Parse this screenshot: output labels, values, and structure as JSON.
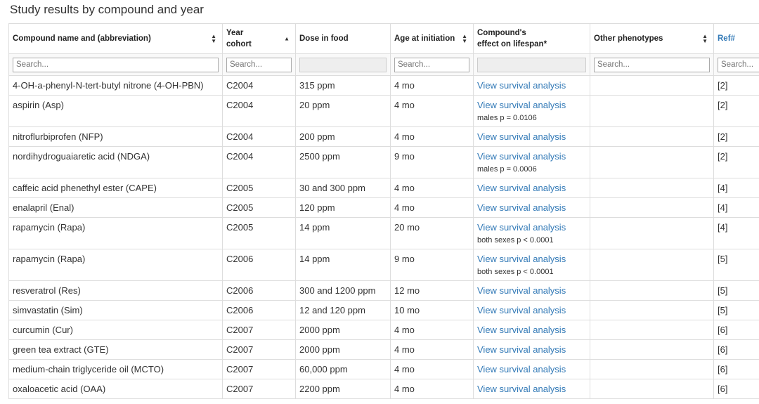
{
  "title": "Study results by compound and year",
  "columns": [
    {
      "line1": "Compound name and (abbreviation)",
      "line2": "",
      "sort": "both"
    },
    {
      "line1": "Year",
      "line2": "cohort",
      "sort": "asc"
    },
    {
      "line1": "Dose in food",
      "line2": "",
      "sort": "none"
    },
    {
      "line1": "Age at initiation",
      "line2": "",
      "sort": "both"
    },
    {
      "line1": "Compound's",
      "line2": "effect on lifespan*",
      "sort": "none"
    },
    {
      "line1": "Other phenotypes",
      "line2": "",
      "sort": "both"
    },
    {
      "line1": "Ref#",
      "line2": "",
      "sort": "none"
    }
  ],
  "filters": [
    "Search...",
    "Search...",
    "",
    "Search...",
    "",
    "Search...",
    "Search..."
  ],
  "link_text": "View survival analysis",
  "rows": [
    {
      "compound": "4-OH-a-phenyl-N-tert-butyl nitrone (4-OH-PBN)",
      "year": "C2004",
      "dose": "315 ppm",
      "age": "4 mo",
      "note": "",
      "other": "",
      "ref": "[2]"
    },
    {
      "compound": "aspirin (Asp)",
      "year": "C2004",
      "dose": "20 ppm",
      "age": "4 mo",
      "note": "males p = 0.0106",
      "other": "",
      "ref": "[2]"
    },
    {
      "compound": "nitroflurbiprofen (NFP)",
      "year": "C2004",
      "dose": "200 ppm",
      "age": "4 mo",
      "note": "",
      "other": "",
      "ref": "[2]"
    },
    {
      "compound": "nordihydroguaiaretic acid (NDGA)",
      "year": "C2004",
      "dose": "2500 ppm",
      "age": "9 mo",
      "note": "males p = 0.0006",
      "other": "",
      "ref": "[2]"
    },
    {
      "compound": "caffeic acid phenethyl ester (CAPE)",
      "year": "C2005",
      "dose": "30 and 300 ppm",
      "age": "4 mo",
      "note": "",
      "other": "",
      "ref": "[4]"
    },
    {
      "compound": "enalapril (Enal)",
      "year": "C2005",
      "dose": "120 ppm",
      "age": "4 mo",
      "note": "",
      "other": "",
      "ref": "[4]"
    },
    {
      "compound": "rapamycin (Rapa)",
      "year": "C2005",
      "dose": "14 ppm",
      "age": "20 mo",
      "note": "both sexes p < 0.0001",
      "other": "",
      "ref": "[4]"
    },
    {
      "compound": "rapamycin (Rapa)",
      "year": "C2006",
      "dose": "14 ppm",
      "age": "9 mo",
      "note": "both sexes p < 0.0001",
      "other": "",
      "ref": "[5]"
    },
    {
      "compound": "resveratrol (Res)",
      "year": "C2006",
      "dose": "300 and 1200 ppm",
      "age": "12 mo",
      "note": "",
      "other": "",
      "ref": "[5]"
    },
    {
      "compound": "simvastatin (Sim)",
      "year": "C2006",
      "dose": "12 and 120 ppm",
      "age": "10 mo",
      "note": "",
      "other": "",
      "ref": "[5]"
    },
    {
      "compound": "curcumin (Cur)",
      "year": "C2007",
      "dose": "2000 ppm",
      "age": "4 mo",
      "note": "",
      "other": "",
      "ref": "[6]"
    },
    {
      "compound": "green tea extract (GTE)",
      "year": "C2007",
      "dose": "2000 ppm",
      "age": "4 mo",
      "note": "",
      "other": "",
      "ref": "[6]"
    },
    {
      "compound": "medium-chain triglyceride oil (MCTO)",
      "year": "C2007",
      "dose": "60,000 ppm",
      "age": "4 mo",
      "note": "",
      "other": "",
      "ref": "[6]"
    },
    {
      "compound": "oxaloacetic acid (OAA)",
      "year": "C2007",
      "dose": "2200 ppm",
      "age": "4 mo",
      "note": "",
      "other": "",
      "ref": "[6]"
    }
  ]
}
